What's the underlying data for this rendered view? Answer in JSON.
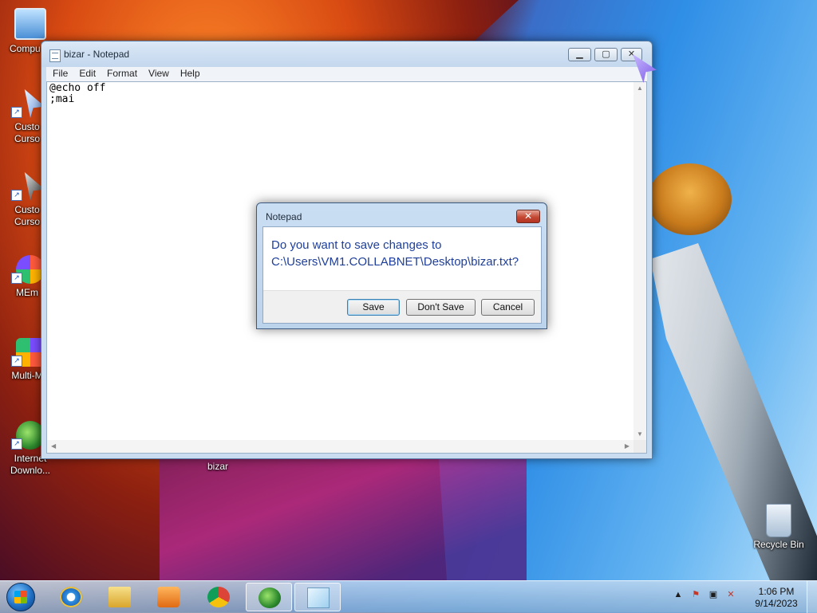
{
  "desktop": {
    "icons": [
      {
        "label": "Compu",
        "icon": "computer-icon"
      },
      {
        "label": "Custo\nCurso",
        "icon": "cursor-shortcut-icon"
      },
      {
        "label": "Custo\nCurso",
        "icon": "cursor-shortcut-icon"
      },
      {
        "label": "MEm",
        "icon": "memu-icon"
      },
      {
        "label": "Multi-M",
        "icon": "multi-memu-icon"
      },
      {
        "label": "Internet\nDownlo...",
        "icon": "idm-icon"
      },
      {
        "label": "bizar",
        "icon": "text-file-icon"
      },
      {
        "label": "Recycle Bin",
        "icon": "recycle-bin-icon"
      }
    ]
  },
  "notepad": {
    "title": "bizar - Notepad",
    "menu": [
      "File",
      "Edit",
      "Format",
      "View",
      "Help"
    ],
    "content_line1": "@echo off",
    "content_line2": ";mai"
  },
  "dialog": {
    "title": "Notepad",
    "message_line1": "Do you want to save changes to",
    "message_line2": "C:\\Users\\VM1.COLLABNET\\Desktop\\bizar.txt?",
    "buttons": {
      "save": "Save",
      "dont_save": "Don't Save",
      "cancel": "Cancel"
    }
  },
  "taskbar": {
    "apps": [
      "internet-explorer-icon",
      "file-explorer-icon",
      "media-player-icon",
      "chrome-icon",
      "idm-icon",
      "notepad-icon"
    ],
    "tray": [
      "show-hidden-icons-icon",
      "action-center-icon",
      "network-icon",
      "volume-muted-icon"
    ],
    "clock_time": "1:06 PM",
    "clock_date": "9/14/2023"
  },
  "colors": {
    "dialog_text": "#1f3f9a",
    "close_red": "#c44a34",
    "window_frame": "#c9dcf0"
  }
}
